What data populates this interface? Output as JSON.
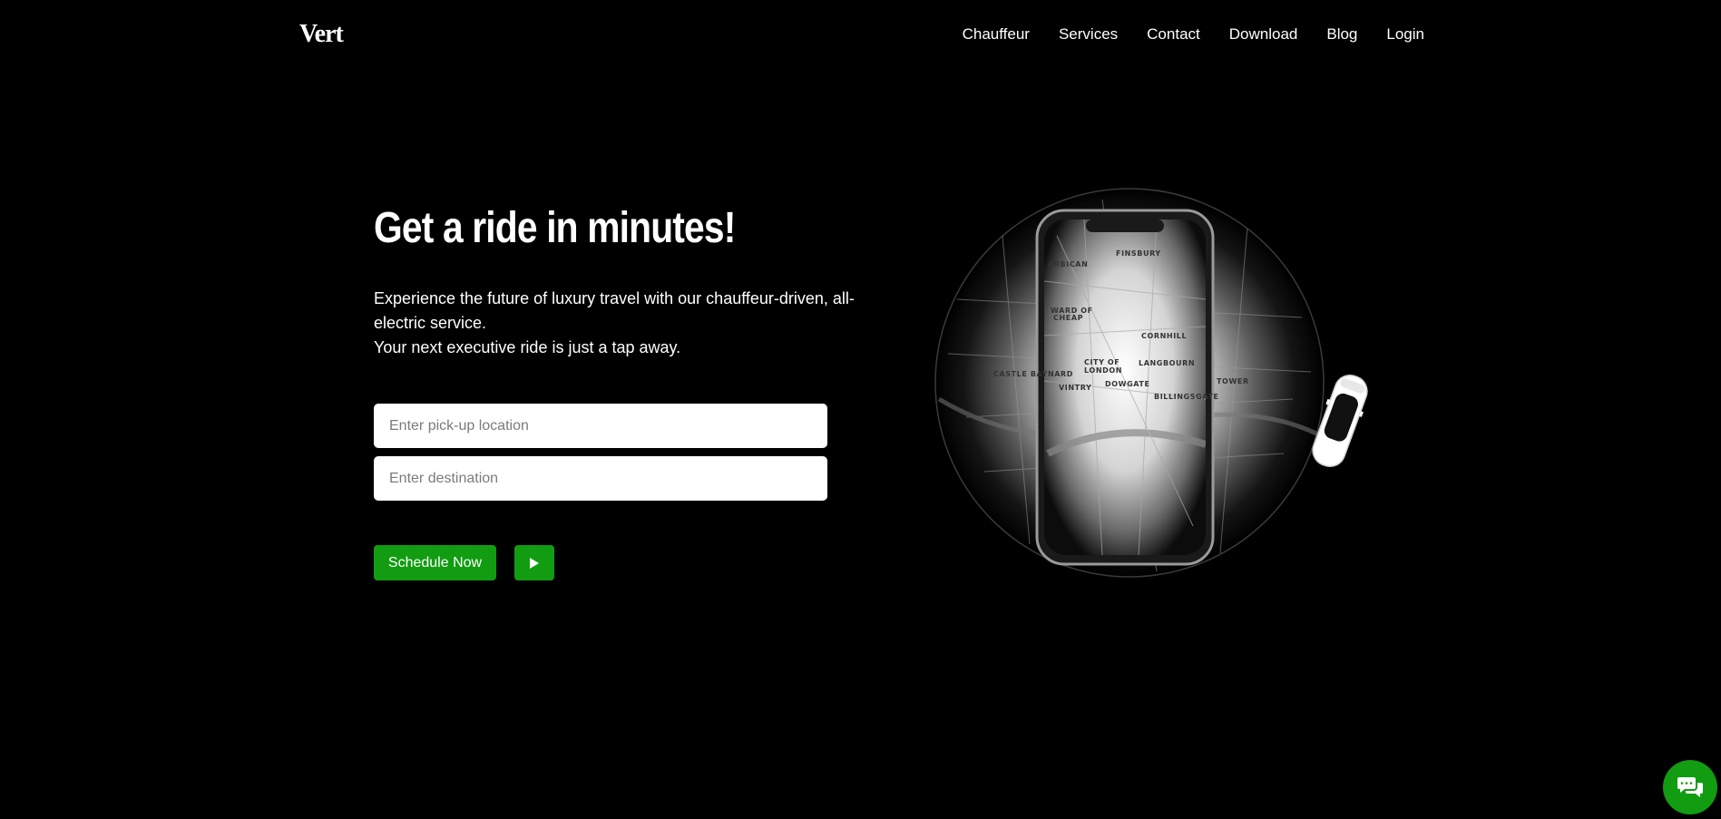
{
  "header": {
    "logo": "Vert",
    "nav": [
      "Chauffeur",
      "Services",
      "Contact",
      "Download",
      "Blog",
      "Login"
    ]
  },
  "hero": {
    "title": "Get a ride in minutes!",
    "description_line1": "Experience the future of luxury travel with our chauffeur-driven, all-electric service.",
    "description_line2": "Your next executive ride is just a tap away.",
    "pickup_placeholder": "Enter pick-up location",
    "destination_placeholder": "Enter destination",
    "schedule_label": "Schedule Now"
  },
  "map_labels": {
    "finsbury": "FINSBURY",
    "barbican": "ARBICAN",
    "ward1": "WARD OF",
    "ward2": "CHEAP",
    "cornhill": "CORNHILL",
    "city1": "CITY OF",
    "city2": "LONDON",
    "langbourn": "LANGBOURN",
    "castle": "CASTLE BAYNARD",
    "vintry": "VINTRY",
    "dowgate": "DOWGATE",
    "billingsgate": "BILLINGSGATE",
    "tower": "TOWER"
  },
  "icons": {
    "play": "play-icon",
    "chat": "chat-icon"
  },
  "colors": {
    "accent": "#129c12",
    "background": "#000000"
  }
}
